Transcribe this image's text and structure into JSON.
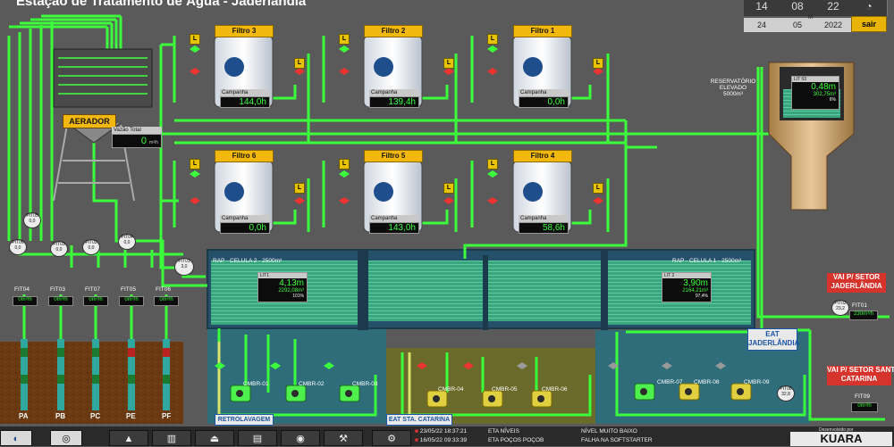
{
  "app": {
    "title": "Estação de Tratamento de Água - Jaderlândia"
  },
  "clock": {
    "hour": "14",
    "min": "08",
    "sec": "22",
    "day": "24",
    "month": "05",
    "year": "2022",
    "m_label": "M",
    "exit_label": "sair"
  },
  "filters": [
    {
      "name": "Filtro 3",
      "campaign_label": "Campanha",
      "value": "144,0h"
    },
    {
      "name": "Filtro 2",
      "campaign_label": "Campanha",
      "value": "139,4h"
    },
    {
      "name": "Filtro 1",
      "campaign_label": "Campanha",
      "value": "0,0h"
    },
    {
      "name": "Filtro 6",
      "campaign_label": "Campanha",
      "value": "0,0h"
    },
    {
      "name": "Filtro 5",
      "campaign_label": "Campanha",
      "value": "143,0h"
    },
    {
      "name": "Filtro 4",
      "campaign_label": "Campanha",
      "value": "58,6h"
    }
  ],
  "aerador": {
    "label": "AERADOR",
    "flow_label": "Vazão Total",
    "flow_value": "0",
    "flow_unit": "m³/h"
  },
  "reservoir": {
    "label1": "RESERVATÓRIO",
    "label2": "ELEVADO",
    "label3": "5000m³",
    "lit": "LIT 03",
    "level": "0,48m",
    "volume": "302,75m³",
    "pct": "6%"
  },
  "rap": {
    "cell2": {
      "title": "RAP - CELULA 2 - 2500m³",
      "lit": "LIT1",
      "level": "4,13m",
      "volume": "2292,08m³",
      "pct": "101%"
    },
    "cell1": {
      "title": "RAP - CELULA 1 - 2500m³",
      "lit": "LIT 2",
      "level": "3,90m",
      "volume": "2164,21m³",
      "pct": "97,4%"
    }
  },
  "wells": [
    "PA",
    "PB",
    "PC",
    "PE",
    "PF"
  ],
  "fit_labels": [
    "FIT04",
    "FIT03",
    "FIT07",
    "FIT05",
    "FIT06"
  ],
  "fit_values": [
    "0m³/h",
    "0m³/h",
    "0m³/h",
    "0m³/h",
    "0m³/h"
  ],
  "pit_gauges": [
    "PIT05",
    "PIT03",
    "PIT02",
    "PIT04",
    "PIT06",
    "PIT01"
  ],
  "pit_values": [
    "0,0",
    "0,0",
    "0,0",
    "0,0",
    "0,0",
    "3,0"
  ],
  "pumps": [
    "CMBR-01",
    "CMBR-02",
    "CMBR-03",
    "CMBR-04",
    "CMBR-05",
    "CMBR-06",
    "CMBR-07",
    "CMBR-08",
    "CMBR-09"
  ],
  "sections": {
    "retro": "RETROLAVAGEM",
    "eat_sta": "EAT STA. CATARINA",
    "eat_jad1": "EAT",
    "eat_jad2": "JADERLÂNDIA"
  },
  "outlets": {
    "jad1": "VAI P/ SETOR",
    "jad2": "JADERLÂNDIA",
    "jad_fit": "FIT01",
    "jad_val": "230m³/h",
    "jad_pit": "PIT02",
    "jad_pit_val": "23,2",
    "sc1": "VAI P/ SETOR SANTA",
    "sc2": "CATARINA",
    "sc_fit": "FIT09",
    "sc_val": "0m³/h",
    "sc_pit": "PIT08",
    "sc_pit_val": "32,8"
  },
  "alarms": [
    {
      "ts": "23/05/22 18:37:21",
      "area": "ETA NÍVEIS",
      "msg": "NÍVEL MUITO BAIXO"
    },
    {
      "ts": "16/05/22 09:33:39",
      "area": "ETA POÇOS POÇOB",
      "msg": "FALHA NA SOFTSTARTER"
    }
  ],
  "footer": {
    "dev_label": "Desenvolvido por",
    "brand": "KUARA"
  },
  "colors": {
    "pipe": "#3cff3c",
    "bg": "#5a5a5a",
    "accent": "#f2b80e",
    "water": "#3aa680",
    "alarm": "#d6332c"
  }
}
